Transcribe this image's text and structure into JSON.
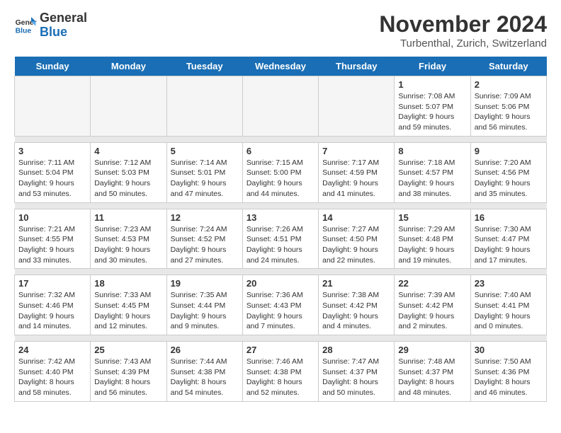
{
  "header": {
    "logo_general": "General",
    "logo_blue": "Blue",
    "month": "November 2024",
    "location": "Turbenthal, Zurich, Switzerland"
  },
  "days_of_week": [
    "Sunday",
    "Monday",
    "Tuesday",
    "Wednesday",
    "Thursday",
    "Friday",
    "Saturday"
  ],
  "weeks": [
    [
      {
        "day": "",
        "empty": true
      },
      {
        "day": "",
        "empty": true
      },
      {
        "day": "",
        "empty": true
      },
      {
        "day": "",
        "empty": true
      },
      {
        "day": "",
        "empty": true
      },
      {
        "day": "1",
        "detail": "Sunrise: 7:08 AM\nSunset: 5:07 PM\nDaylight: 9 hours and 59 minutes."
      },
      {
        "day": "2",
        "detail": "Sunrise: 7:09 AM\nSunset: 5:06 PM\nDaylight: 9 hours and 56 minutes."
      }
    ],
    [
      {
        "day": "3",
        "detail": "Sunrise: 7:11 AM\nSunset: 5:04 PM\nDaylight: 9 hours and 53 minutes."
      },
      {
        "day": "4",
        "detail": "Sunrise: 7:12 AM\nSunset: 5:03 PM\nDaylight: 9 hours and 50 minutes."
      },
      {
        "day": "5",
        "detail": "Sunrise: 7:14 AM\nSunset: 5:01 PM\nDaylight: 9 hours and 47 minutes."
      },
      {
        "day": "6",
        "detail": "Sunrise: 7:15 AM\nSunset: 5:00 PM\nDaylight: 9 hours and 44 minutes."
      },
      {
        "day": "7",
        "detail": "Sunrise: 7:17 AM\nSunset: 4:59 PM\nDaylight: 9 hours and 41 minutes."
      },
      {
        "day": "8",
        "detail": "Sunrise: 7:18 AM\nSunset: 4:57 PM\nDaylight: 9 hours and 38 minutes."
      },
      {
        "day": "9",
        "detail": "Sunrise: 7:20 AM\nSunset: 4:56 PM\nDaylight: 9 hours and 35 minutes."
      }
    ],
    [
      {
        "day": "10",
        "detail": "Sunrise: 7:21 AM\nSunset: 4:55 PM\nDaylight: 9 hours and 33 minutes."
      },
      {
        "day": "11",
        "detail": "Sunrise: 7:23 AM\nSunset: 4:53 PM\nDaylight: 9 hours and 30 minutes."
      },
      {
        "day": "12",
        "detail": "Sunrise: 7:24 AM\nSunset: 4:52 PM\nDaylight: 9 hours and 27 minutes."
      },
      {
        "day": "13",
        "detail": "Sunrise: 7:26 AM\nSunset: 4:51 PM\nDaylight: 9 hours and 24 minutes."
      },
      {
        "day": "14",
        "detail": "Sunrise: 7:27 AM\nSunset: 4:50 PM\nDaylight: 9 hours and 22 minutes."
      },
      {
        "day": "15",
        "detail": "Sunrise: 7:29 AM\nSunset: 4:48 PM\nDaylight: 9 hours and 19 minutes."
      },
      {
        "day": "16",
        "detail": "Sunrise: 7:30 AM\nSunset: 4:47 PM\nDaylight: 9 hours and 17 minutes."
      }
    ],
    [
      {
        "day": "17",
        "detail": "Sunrise: 7:32 AM\nSunset: 4:46 PM\nDaylight: 9 hours and 14 minutes."
      },
      {
        "day": "18",
        "detail": "Sunrise: 7:33 AM\nSunset: 4:45 PM\nDaylight: 9 hours and 12 minutes."
      },
      {
        "day": "19",
        "detail": "Sunrise: 7:35 AM\nSunset: 4:44 PM\nDaylight: 9 hours and 9 minutes."
      },
      {
        "day": "20",
        "detail": "Sunrise: 7:36 AM\nSunset: 4:43 PM\nDaylight: 9 hours and 7 minutes."
      },
      {
        "day": "21",
        "detail": "Sunrise: 7:38 AM\nSunset: 4:42 PM\nDaylight: 9 hours and 4 minutes."
      },
      {
        "day": "22",
        "detail": "Sunrise: 7:39 AM\nSunset: 4:42 PM\nDaylight: 9 hours and 2 minutes."
      },
      {
        "day": "23",
        "detail": "Sunrise: 7:40 AM\nSunset: 4:41 PM\nDaylight: 9 hours and 0 minutes."
      }
    ],
    [
      {
        "day": "24",
        "detail": "Sunrise: 7:42 AM\nSunset: 4:40 PM\nDaylight: 8 hours and 58 minutes."
      },
      {
        "day": "25",
        "detail": "Sunrise: 7:43 AM\nSunset: 4:39 PM\nDaylight: 8 hours and 56 minutes."
      },
      {
        "day": "26",
        "detail": "Sunrise: 7:44 AM\nSunset: 4:38 PM\nDaylight: 8 hours and 54 minutes."
      },
      {
        "day": "27",
        "detail": "Sunrise: 7:46 AM\nSunset: 4:38 PM\nDaylight: 8 hours and 52 minutes."
      },
      {
        "day": "28",
        "detail": "Sunrise: 7:47 AM\nSunset: 4:37 PM\nDaylight: 8 hours and 50 minutes."
      },
      {
        "day": "29",
        "detail": "Sunrise: 7:48 AM\nSunset: 4:37 PM\nDaylight: 8 hours and 48 minutes."
      },
      {
        "day": "30",
        "detail": "Sunrise: 7:50 AM\nSunset: 4:36 PM\nDaylight: 8 hours and 46 minutes."
      }
    ]
  ]
}
